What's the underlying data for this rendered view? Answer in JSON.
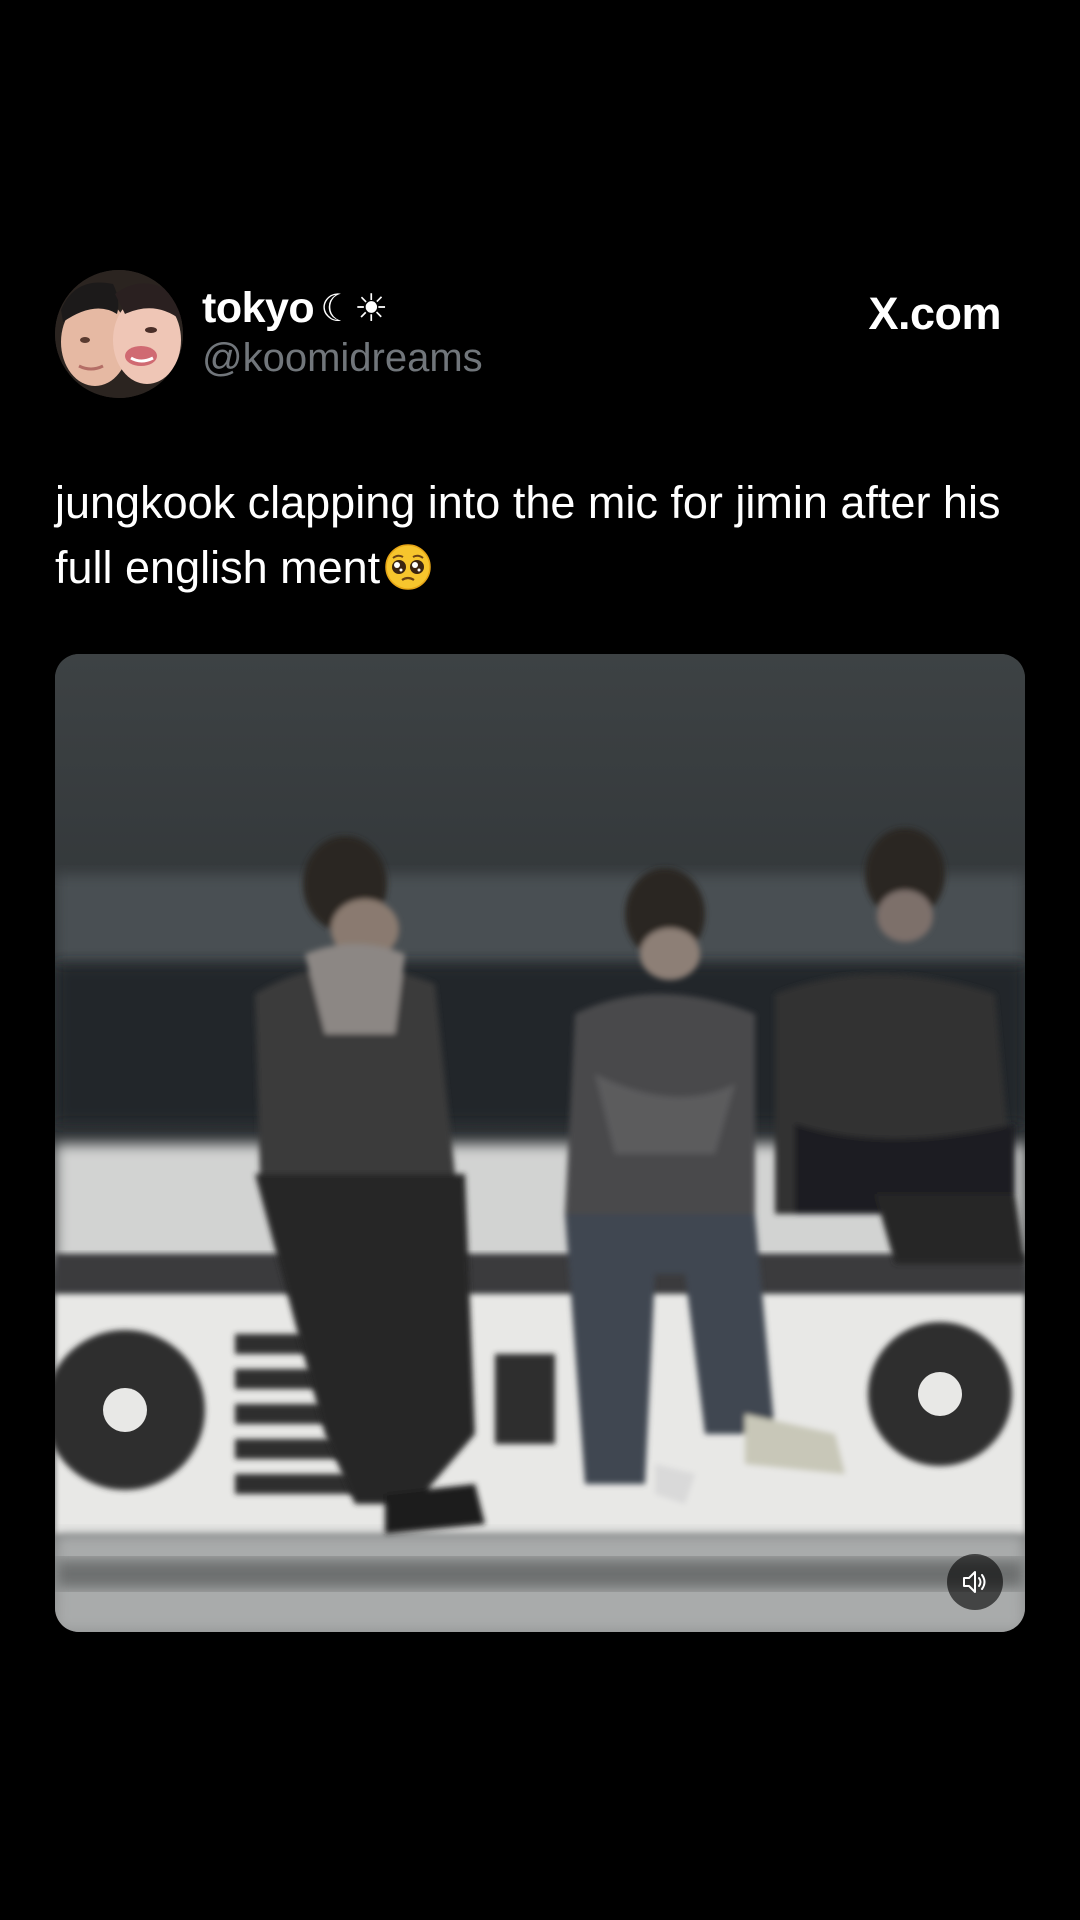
{
  "author": {
    "display_name": "tokyo",
    "name_decoration": "☾☀",
    "handle": "@koomidreams"
  },
  "site_label": "X.com",
  "post": {
    "text": "jungkook clapping into the mic for jimin after his full english ment",
    "emoji": "pleading-face-emoji"
  },
  "media": {
    "type": "video",
    "mute_icon": "speaker-icon"
  },
  "colors": {
    "background": "#000000",
    "text_primary": "#ffffff",
    "text_secondary": "#71767b"
  }
}
